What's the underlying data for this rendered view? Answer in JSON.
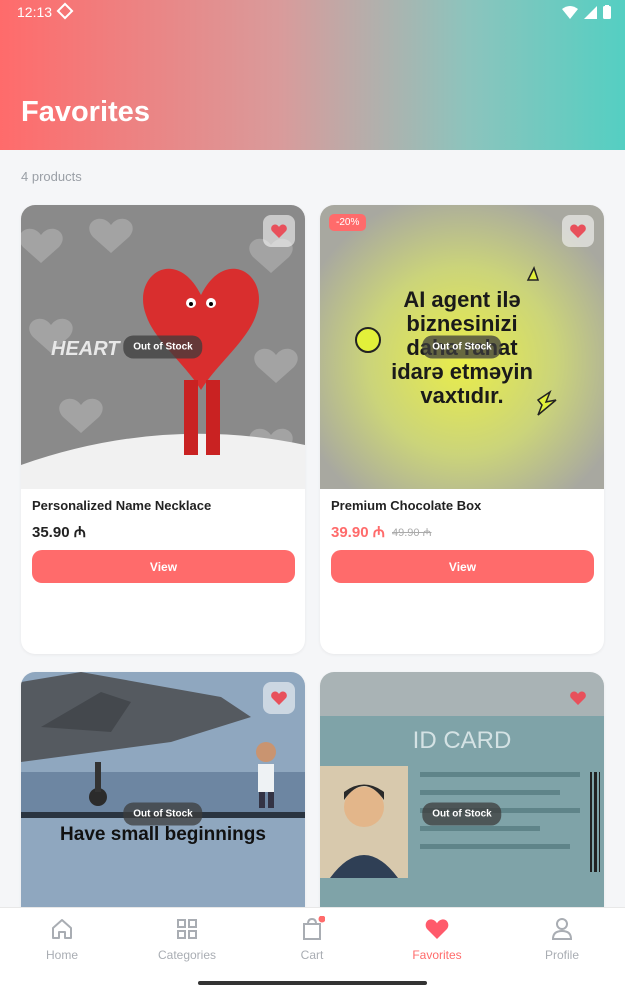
{
  "status_bar": {
    "time": "12:13"
  },
  "header": {
    "title": "Favorites"
  },
  "product_count": "4 products",
  "products": [
    {
      "name": "Personalized Name Necklace",
      "price": "35.90 ₼",
      "stock_label": "Out of Stock",
      "view_label": "View",
      "image_text": "HEART"
    },
    {
      "name": "Premium Chocolate Box",
      "price": "39.90 ₼",
      "old_price": "49.90 ₼",
      "discount": "-20%",
      "stock_label": "Out of Stock",
      "view_label": "View",
      "image_text_lines": [
        "AI agent ilə",
        "biznesinizi",
        "daha rahat",
        "idarə etməyin",
        "vaxtıdır."
      ]
    },
    {
      "name": "",
      "stock_label": "Out of Stock",
      "image_text": "Have small beginnings"
    },
    {
      "name": "",
      "stock_label": "Out of Stock",
      "image_text": "ID CARD"
    }
  ],
  "bottom_nav": {
    "items": [
      {
        "label": "Home",
        "icon": "home-icon"
      },
      {
        "label": "Categories",
        "icon": "grid-icon"
      },
      {
        "label": "Cart",
        "icon": "bag-icon"
      },
      {
        "label": "Favorites",
        "icon": "heart-icon",
        "active": true
      },
      {
        "label": "Profile",
        "icon": "person-icon"
      }
    ]
  },
  "colors": {
    "accent": "#ff6b6b",
    "teal": "#54cfc2"
  }
}
